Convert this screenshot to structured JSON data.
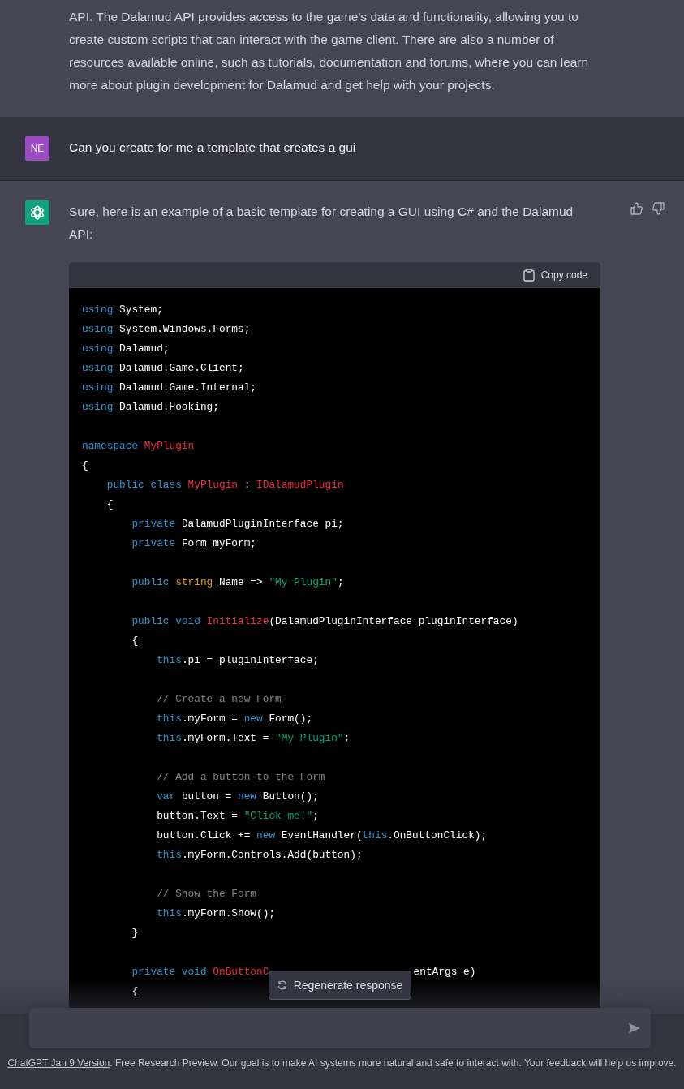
{
  "messages": [
    {
      "kind": "assistant",
      "text": "API. The Dalamud API provides access to the game's data and functionality, allowing you to create custom scripts that can interact with the game client. There are also a number of resources available online, such as tutorials, documentation and forums, where you can learn more about plugin development for Dalamud and get help with your projects."
    },
    {
      "kind": "user",
      "avatar": {
        "kind": "initials",
        "text": "NE"
      },
      "text": "Can you create for me a template that creates a gui"
    },
    {
      "kind": "assistant",
      "avatar": {
        "kind": "logo"
      },
      "feedback": true,
      "text": "Sure, here is an example of a basic template for creating a GUI using C# and the Dalamud API:",
      "code_block": {
        "copy_label": "Copy code",
        "blocks": [
          {
            "lines": [
              {
                "tokens": [
                  {
                    "kind": "kw",
                    "text": "using "
                  },
                  {
                    "kind": "plain",
                    "text": "System;"
                  }
                ]
              },
              {
                "tokens": [
                  {
                    "kind": "kw",
                    "text": "using "
                  },
                  {
                    "kind": "plain",
                    "text": "System.Windows.Forms;"
                  }
                ]
              },
              {
                "tokens": [
                  {
                    "kind": "kw",
                    "text": "using "
                  },
                  {
                    "kind": "plain",
                    "text": "Dalamud;"
                  }
                ]
              },
              {
                "tokens": [
                  {
                    "kind": "kw",
                    "text": "using "
                  },
                  {
                    "kind": "plain",
                    "text": "Dalamud.Game.Client;"
                  }
                ]
              },
              {
                "tokens": [
                  {
                    "kind": "kw",
                    "text": "using "
                  },
                  {
                    "kind": "plain",
                    "text": "Dalamud.Game.Internal;"
                  }
                ]
              },
              {
                "tokens": [
                  {
                    "kind": "kw",
                    "text": "using "
                  },
                  {
                    "kind": "plain",
                    "text": "Dalamud.Hooking;"
                  }
                ]
              }
            ]
          },
          {
            "lines": [
              {
                "tokens": [
                  {
                    "kind": "kw",
                    "text": "namespace "
                  },
                  {
                    "kind": "cls",
                    "text": "MyPlugin"
                  }
                ]
              },
              {
                "tokens": [
                  {
                    "kind": "plain",
                    "text": "{"
                  }
                ]
              },
              {
                "tokens": [
                  {
                    "kind": "kw",
                    "text": "    public class "
                  },
                  {
                    "kind": "cls",
                    "text": "MyPlugin"
                  },
                  {
                    "kind": "plain",
                    "text": " : "
                  },
                  {
                    "kind": "cls",
                    "text": "IDalamudPlugin"
                  }
                ]
              },
              {
                "tokens": [
                  {
                    "kind": "plain",
                    "text": "    {"
                  }
                ]
              },
              {
                "tokens": [
                  {
                    "kind": "kw",
                    "text": "        private "
                  },
                  {
                    "kind": "plain",
                    "text": "DalamudPluginInterface pi;"
                  }
                ]
              },
              {
                "tokens": [
                  {
                    "kind": "kw",
                    "text": "        private "
                  },
                  {
                    "kind": "plain",
                    "text": "Form myForm;"
                  }
                ]
              }
            ]
          },
          {
            "lines": [
              {
                "tokens": [
                  {
                    "kind": "kw",
                    "text": "        public "
                  },
                  {
                    "kind": "type",
                    "text": "string "
                  },
                  {
                    "kind": "plain",
                    "text": "Name => "
                  },
                  {
                    "kind": "str",
                    "text": "\"My Plugin\""
                  },
                  {
                    "kind": "plain",
                    "text": ";"
                  }
                ]
              }
            ]
          },
          {
            "lines": [
              {
                "tokens": [
                  {
                    "kind": "kw",
                    "text": "        public void "
                  },
                  {
                    "kind": "cls",
                    "text": "Initialize"
                  },
                  {
                    "kind": "plain",
                    "text": "(DalamudPluginInterface pluginInterface)"
                  }
                ]
              },
              {
                "tokens": [
                  {
                    "kind": "plain",
                    "text": "        {"
                  }
                ]
              },
              {
                "tokens": [
                  {
                    "kind": "kw",
                    "text": "            this"
                  },
                  {
                    "kind": "plain",
                    "text": ".pi = pluginInterface;"
                  }
                ]
              }
            ]
          },
          {
            "lines": [
              {
                "tokens": [
                  {
                    "kind": "comment",
                    "text": "            // Create a new Form"
                  }
                ]
              },
              {
                "tokens": [
                  {
                    "kind": "kw",
                    "text": "            this"
                  },
                  {
                    "kind": "plain",
                    "text": ".myForm = "
                  },
                  {
                    "kind": "kw",
                    "text": "new "
                  },
                  {
                    "kind": "plain",
                    "text": "Form();"
                  }
                ]
              },
              {
                "tokens": [
                  {
                    "kind": "kw",
                    "text": "            this"
                  },
                  {
                    "kind": "plain",
                    "text": ".myForm.Text = "
                  },
                  {
                    "kind": "str",
                    "text": "\"My Plugin\""
                  },
                  {
                    "kind": "plain",
                    "text": ";"
                  }
                ]
              }
            ]
          },
          {
            "lines": [
              {
                "tokens": [
                  {
                    "kind": "comment",
                    "text": "            // Add a button to the Form"
                  }
                ]
              },
              {
                "tokens": [
                  {
                    "kind": "kw",
                    "text": "            var "
                  },
                  {
                    "kind": "plain",
                    "text": "button = "
                  },
                  {
                    "kind": "kw",
                    "text": "new "
                  },
                  {
                    "kind": "plain",
                    "text": "Button();"
                  }
                ]
              },
              {
                "tokens": [
                  {
                    "kind": "plain",
                    "text": "            button.Text = "
                  },
                  {
                    "kind": "str",
                    "text": "\"Click me!\""
                  },
                  {
                    "kind": "plain",
                    "text": ";"
                  }
                ]
              },
              {
                "tokens": [
                  {
                    "kind": "plain",
                    "text": "            button.Click += "
                  },
                  {
                    "kind": "kw",
                    "text": "new "
                  },
                  {
                    "kind": "plain",
                    "text": "EventHandler("
                  },
                  {
                    "kind": "kw",
                    "text": "this"
                  },
                  {
                    "kind": "plain",
                    "text": ".OnButtonClick);"
                  }
                ]
              },
              {
                "tokens": [
                  {
                    "kind": "kw",
                    "text": "            this"
                  },
                  {
                    "kind": "plain",
                    "text": ".myForm.Controls.Add(button);"
                  }
                ]
              }
            ]
          },
          {
            "lines": [
              {
                "tokens": [
                  {
                    "kind": "comment",
                    "text": "            // Show the Form"
                  }
                ]
              },
              {
                "tokens": [
                  {
                    "kind": "kw",
                    "text": "            this"
                  },
                  {
                    "kind": "plain",
                    "text": ".myForm.Show();"
                  }
                ]
              },
              {
                "tokens": [
                  {
                    "kind": "plain",
                    "text": "        }"
                  }
                ]
              }
            ]
          },
          {
            "lines": [
              {
                "tokens": [
                  {
                    "kind": "kw",
                    "text": "        private void "
                  },
                  {
                    "kind": "cls",
                    "text": "OnButtonC"
                  },
                  {
                    "kind": "gap"
                  },
                  {
                    "kind": "plain",
                    "text": "entArgs e)"
                  }
                ]
              },
              {
                "tokens": [
                  {
                    "kind": "plain",
                    "text": "        {"
                  }
                ]
              }
            ]
          }
        ]
      }
    }
  ],
  "regenerate_label": "Regenerate response",
  "footer": {
    "link": "ChatGPT Jan 9 Version",
    "text": ". Free Research Preview. Our goal is to make AI systems more natural and safe to interact with. Your feedback will help us improve."
  }
}
